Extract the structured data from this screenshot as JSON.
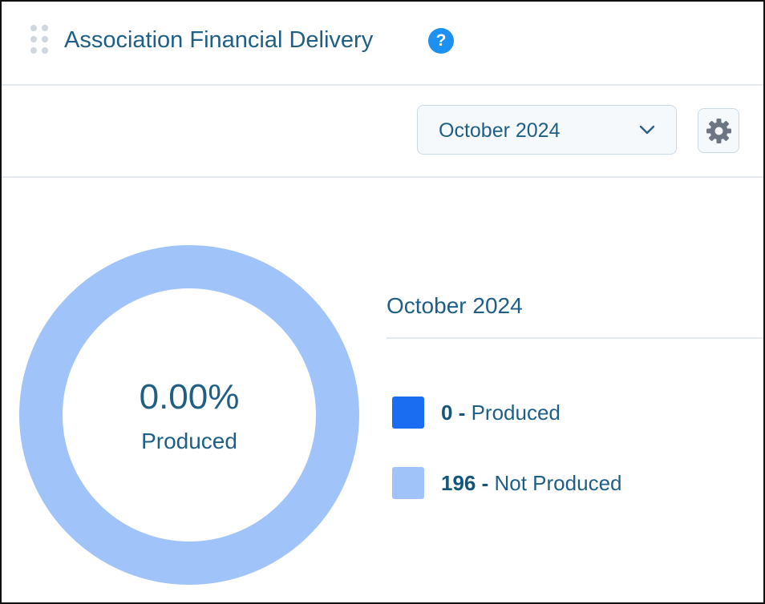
{
  "header": {
    "title": "Association Financial Delivery",
    "help_icon": "help-icon",
    "help_glyph": "?"
  },
  "toolbar": {
    "month_select": {
      "selected": "October 2024"
    },
    "settings_icon": "gear-icon"
  },
  "chart": {
    "center_value": "0.00%",
    "center_label": "Produced",
    "legend_title": "October 2024",
    "legend": [
      {
        "count": "0",
        "separator": " - ",
        "label": "Produced",
        "color": "#1a6df0"
      },
      {
        "count": "196",
        "separator": " - ",
        "label": "Not Produced",
        "color": "#a0c4fa"
      }
    ]
  },
  "chart_data": {
    "type": "pie",
    "categories": [
      "Produced",
      "Not Produced"
    ],
    "values": [
      0,
      196
    ],
    "colors": [
      "#1a6df0",
      "#a0c4fa"
    ]
  },
  "colors": {
    "text": "#1f5f86",
    "accent": "#1c91f2",
    "border": "#e3e9ef"
  }
}
